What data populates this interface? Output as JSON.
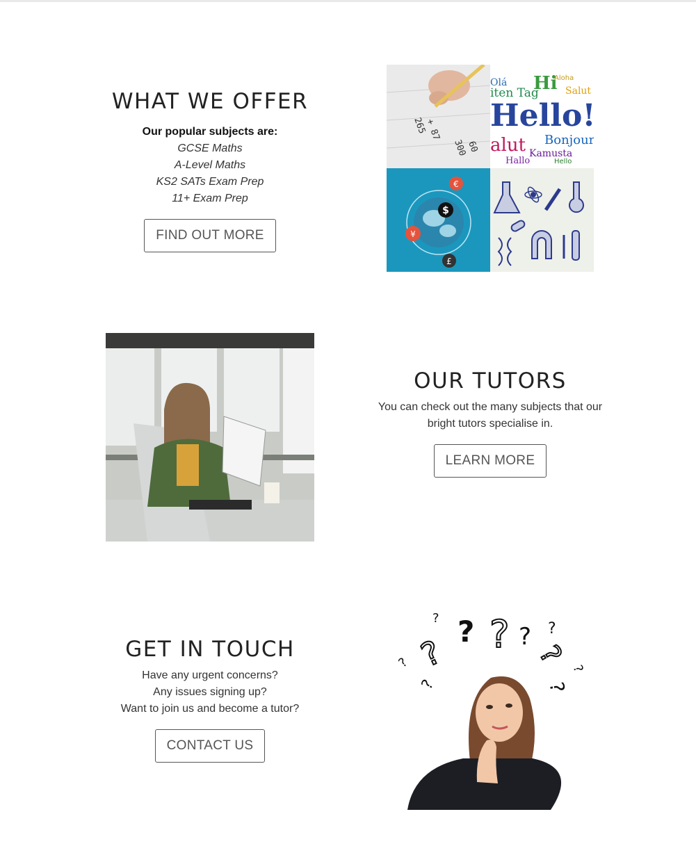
{
  "offer": {
    "title": "WHAT WE OFFER",
    "intro": "Our popular subjects are:",
    "subjects": [
      "GCSE Maths",
      "A-Level Maths",
      "KS2 SATs Exam Prep",
      "11+ Exam Prep"
    ],
    "button": "FIND OUT MORE",
    "image_tiles": [
      "maths-worksheet",
      "hello-word-cloud",
      "currency-globe",
      "science-sketches"
    ]
  },
  "tutors": {
    "title": "OUR TUTORS",
    "lines": [
      "You can check out the many subjects that our",
      "bright tutors specialise in."
    ],
    "button": "LEARN MORE"
  },
  "contact": {
    "title": "GET IN TOUCH",
    "lines": [
      "Have any urgent concerns?",
      "Any issues signing up?",
      "Want to join us and become a tutor?"
    ],
    "button": "CONTACT US"
  },
  "colors": {
    "button_border": "#555555",
    "heading": "#222222",
    "tile_blue": "#1b97be"
  }
}
